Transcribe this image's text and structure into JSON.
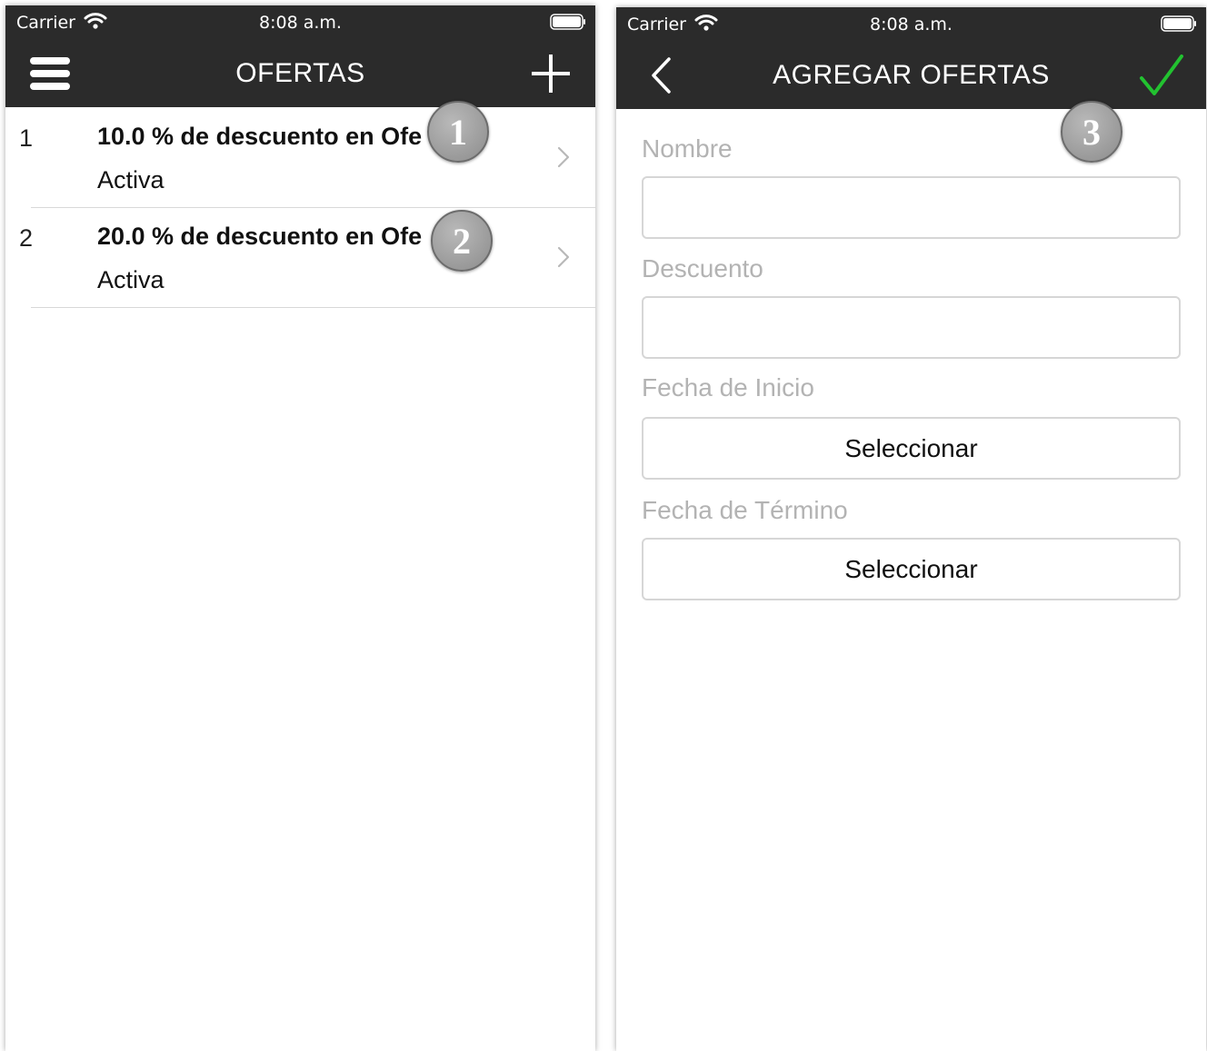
{
  "left_screen": {
    "status": {
      "carrier": "Carrier",
      "time": "8:08 a.m."
    },
    "nav": {
      "title": "OFERTAS",
      "left_icon": "menu-icon",
      "right_icon": "plus-icon"
    },
    "rows": [
      {
        "index": "1",
        "title": "10.0 % de descuento en Ofe",
        "status": "Activa"
      },
      {
        "index": "2",
        "title": "20.0 % de descuento en Ofe",
        "status": "Activa"
      }
    ],
    "callouts": [
      "1",
      "2"
    ]
  },
  "right_screen": {
    "status": {
      "carrier": "Carrier",
      "time": "8:08 a.m."
    },
    "nav": {
      "title": "AGREGAR OFERTAS",
      "left_icon": "back-chevron-icon",
      "right_icon": "checkmark-icon"
    },
    "form": {
      "nombre_label": "Nombre",
      "nombre_value": "",
      "descuento_label": "Descuento",
      "descuento_value": "",
      "fecha_inicio_label": "Fecha de Inicio",
      "fecha_inicio_button": "Seleccionar",
      "fecha_termino_label": "Fecha de Término",
      "fecha_termino_button": "Seleccionar"
    },
    "callouts": [
      "3"
    ]
  },
  "colors": {
    "navbar_bg": "#2b2b2b",
    "check_green": "#22c230",
    "callout_gray": "#9a9a9a"
  }
}
